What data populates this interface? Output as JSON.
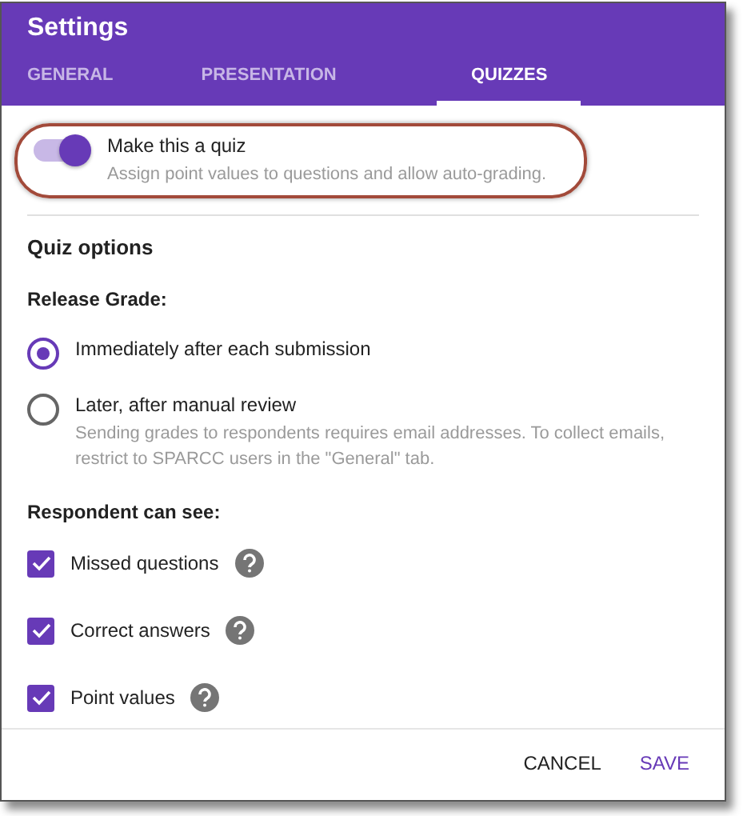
{
  "window": {
    "title": "Settings"
  },
  "tabs": [
    {
      "label": "GENERAL",
      "selected": false
    },
    {
      "label": "PRESENTATION",
      "selected": false
    },
    {
      "label": "QUIZZES",
      "selected": true
    }
  ],
  "quiz_toggle": {
    "label": "Make this a quiz",
    "description": "Assign point values to questions and allow auto-grading.",
    "on": true,
    "highlighted": true
  },
  "section_title": "Quiz options",
  "release_grade": {
    "heading": "Release Grade:",
    "options": [
      {
        "label": "Immediately after each submission",
        "selected": true
      },
      {
        "label": "Later, after manual review",
        "description": "Sending grades to respondents requires email addresses. To collect emails, restrict to SPARCC users in the \"General\" tab.",
        "selected": false
      }
    ]
  },
  "respondent_can_see": {
    "heading": "Respondent can see:",
    "options": [
      {
        "label": "Missed questions",
        "checked": true
      },
      {
        "label": "Correct answers",
        "checked": true
      },
      {
        "label": "Point values",
        "checked": true
      }
    ]
  },
  "buttons": [
    {
      "label": "CANCEL",
      "kind": "plain"
    },
    {
      "label": "SAVE",
      "kind": "primary"
    }
  ]
}
